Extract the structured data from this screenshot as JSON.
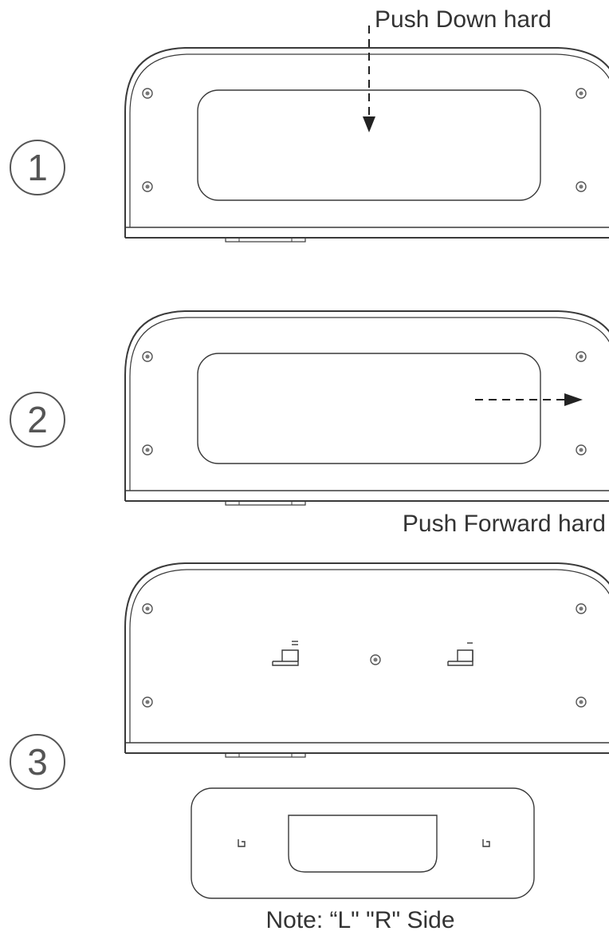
{
  "steps": [
    {
      "number": "1",
      "instruction": "Push Down hard"
    },
    {
      "number": "2",
      "instruction": "Push Forward hard"
    },
    {
      "number": "3",
      "instruction": ""
    }
  ],
  "note": "Note: “L\" \"R\" Side",
  "icons": {
    "step_marker": "circled-number",
    "down_arrow": "dashed-arrow-down",
    "forward_arrow": "dashed-arrow-right",
    "screw": "screw-icon"
  },
  "colors": {
    "line": "#3a3a3a",
    "text": "#333333"
  }
}
